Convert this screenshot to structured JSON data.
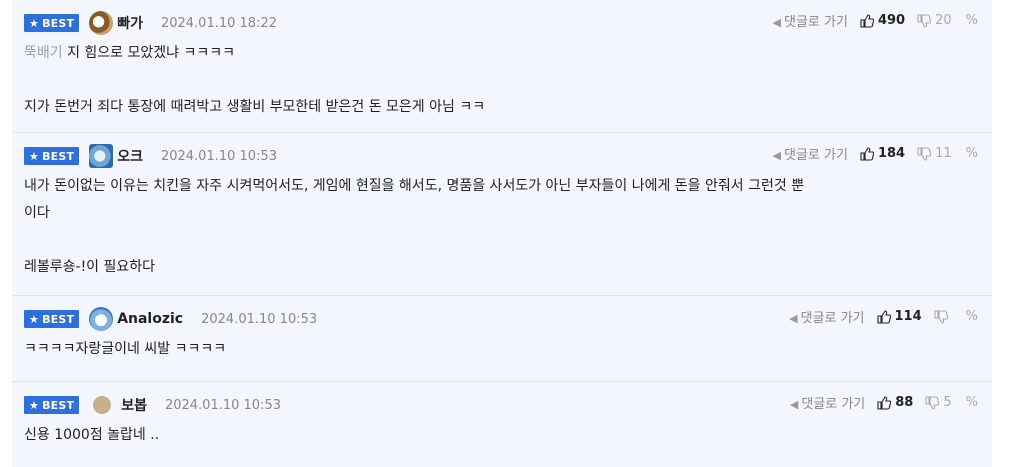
{
  "common": {
    "badge_label": "BEST",
    "goto_label": "댓글로 가기"
  },
  "comments": [
    {
      "nick": "빠가",
      "date": "2024.01.10 18:22",
      "up": "490",
      "down": "20",
      "prefix": "뚝배기",
      "line1": " 지 힘으로 모았겠냐 ㅋㅋㅋㅋ",
      "line2": "지가 돈번거 죄다 통장에 때려박고 생활비 부모한테 받은건 돈 모은게 아님 ㅋㅋ"
    },
    {
      "nick": "오크",
      "date": "2024.01.10 10:53",
      "up": "184",
      "down": "11",
      "line1": "내가 돈이없는 이유는 치킨을 자주 시켜먹어서도, 게임에 현질을 해서도, 명품을 사서도가 아닌 부자들이 나에게 돈을 안줘서 그런것 뿐",
      "line1b": "이다",
      "line2": "레볼루숑-!이 필요하다"
    },
    {
      "nick": "Analozic",
      "date": "2024.01.10 10:53",
      "up": "114",
      "down": "",
      "line1": "ㅋㅋㅋㅋ자랑글이네 씨발 ㅋㅋㅋㅋ"
    },
    {
      "nick": "보봅",
      "date": "2024.01.10 10:53",
      "up": "88",
      "down": "5",
      "line1": "신용 1000점 놀랍네 .."
    }
  ]
}
